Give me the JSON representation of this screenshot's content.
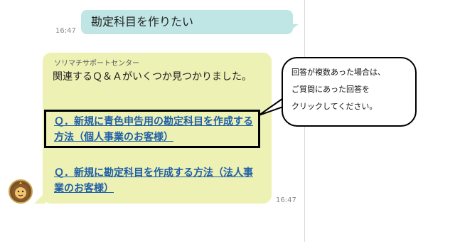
{
  "user_message": {
    "text": "勘定科目を作りたい",
    "time": "16:47"
  },
  "bot_message": {
    "sender": "ソリマチサポートセンター",
    "text": "関連するＱ＆Ａがいくつか見つかりました。",
    "time": "16:47",
    "links": [
      {
        "label": "Ｑ．新規に青色申告用の勘定科目を作成する方法（個人事業のお客様）"
      },
      {
        "label": "Ｑ．新規に勘定科目を作成する方法（法人事業のお客様）"
      }
    ]
  },
  "callout": {
    "text": "回答が複数あった場合は、\nご質問にあった回答を\nクリックしてください。"
  },
  "colors": {
    "user_bubble": "#bfe6e4",
    "bot_bubble": "#edf1b3",
    "link": "#1f5fa8"
  }
}
